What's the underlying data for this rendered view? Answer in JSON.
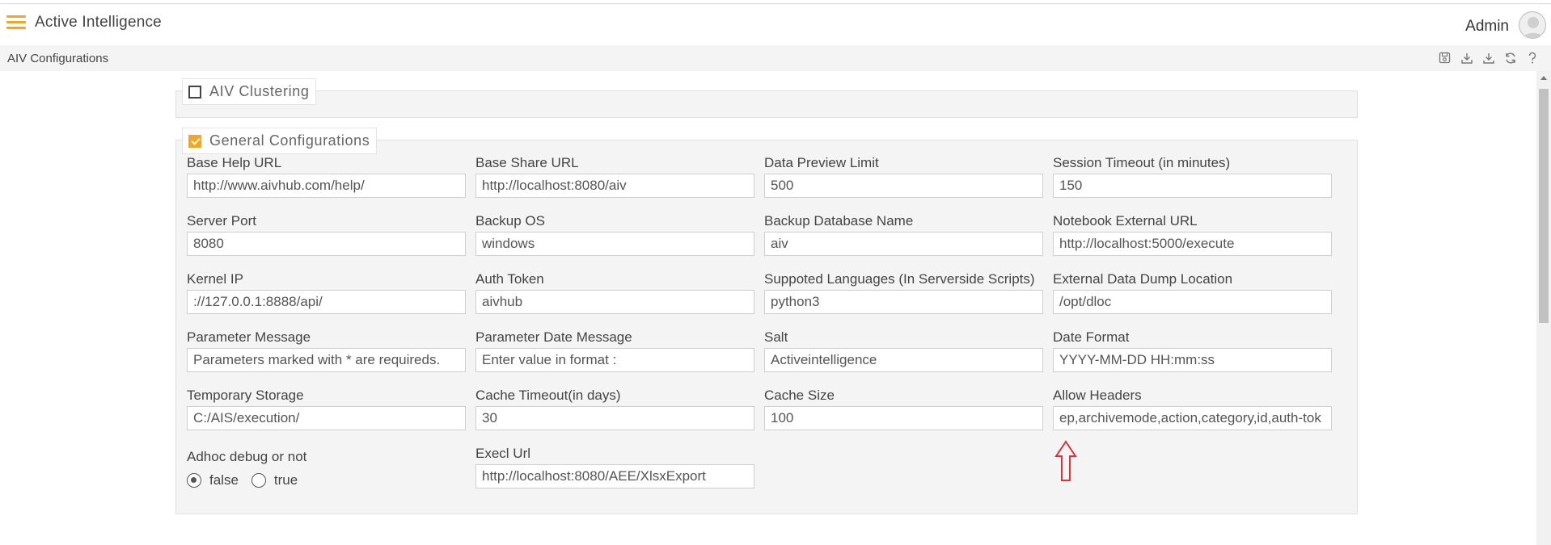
{
  "header": {
    "app_title": "Active Intelligence",
    "user_name": "Admin"
  },
  "subheader": {
    "page_title": "AIV Configurations",
    "tools": [
      "save-icon",
      "download-icon",
      "download-alt-icon",
      "refresh-icon",
      "help-icon"
    ]
  },
  "clustering": {
    "legend": "AIV Clustering",
    "checked": false
  },
  "general": {
    "legend": "General Configurations",
    "checked": true,
    "fields": [
      {
        "label": "Base Help URL",
        "value": "http://www.aivhub.com/help/"
      },
      {
        "label": "Base Share URL",
        "value": "http://localhost:8080/aiv"
      },
      {
        "label": "Data Preview Limit",
        "value": "500"
      },
      {
        "label": "Session Timeout (in minutes)",
        "value": "150"
      },
      {
        "label": "Server Port",
        "value": "8080"
      },
      {
        "label": "Backup OS",
        "value": "windows"
      },
      {
        "label": "Backup Database Name",
        "value": "aiv"
      },
      {
        "label": "Notebook External URL",
        "value": "http://localhost:5000/execute"
      },
      {
        "label": "Kernel IP",
        "value": "://127.0.0.1:8888/api/"
      },
      {
        "label": "Auth Token",
        "value": "aivhub"
      },
      {
        "label": "Suppoted Languages (In Serverside Scripts)",
        "value": "python3"
      },
      {
        "label": "External Data Dump Location",
        "value": "/opt/dloc"
      },
      {
        "label": "Parameter Message",
        "value": "Parameters marked with * are requireds."
      },
      {
        "label": "Parameter Date Message",
        "value": "Enter value in format :"
      },
      {
        "label": "Salt",
        "value": "Activeintelligence"
      },
      {
        "label": "Date Format",
        "value": "YYYY-MM-DD HH:mm:ss"
      },
      {
        "label": "Temporary Storage",
        "value": "C:/AIS/execution/"
      },
      {
        "label": "Cache Timeout(in days)",
        "value": "30"
      },
      {
        "label": "Cache Size",
        "value": "100"
      },
      {
        "label": "Allow Headers",
        "value": "ep,archivemode,action,category,id,auth-tok"
      }
    ],
    "adhoc": {
      "label": "Adhoc debug or not",
      "options": [
        "false",
        "true"
      ],
      "selected": "false"
    },
    "exec_url": {
      "label": "Execl Url",
      "value": "http://localhost:8080/AEE/XlsxExport"
    }
  },
  "colors": {
    "accent": "#f2a628",
    "annotation_arrow": "#d9323c"
  }
}
